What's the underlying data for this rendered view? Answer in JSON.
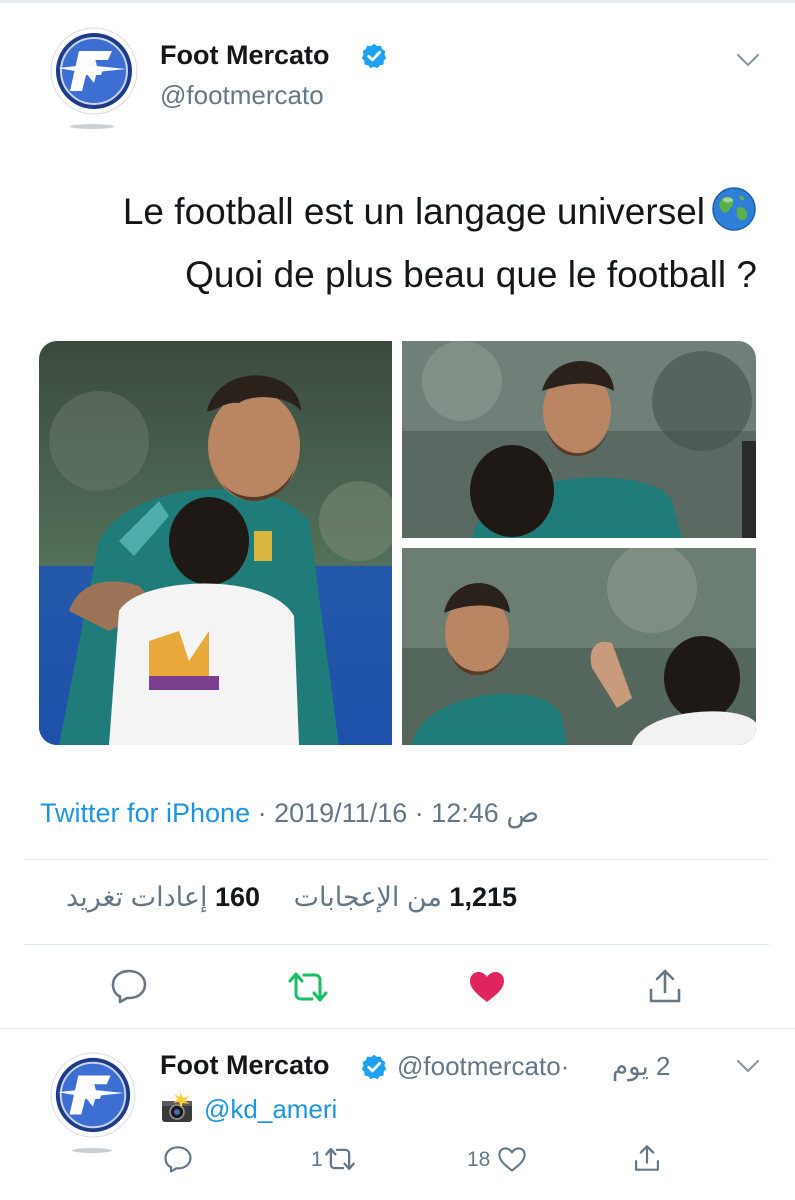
{
  "tweet": {
    "author_name": "Foot Mercato",
    "author_handle": "@footmercato",
    "text_line1": "Le football est un langage universel",
    "text_line2": "Quoi de plus beau que le football ?",
    "source": "Twitter for iPhone",
    "separator": " · ",
    "date": "2019/11/16",
    "time": "12:46 ص",
    "likes_count": "1,215",
    "likes_label": "من الإعجابات",
    "retweets_count": "160",
    "retweets_label": "إعادات تغريد",
    "liked": true,
    "icons": [
      "verified-badge-icon",
      "chevron-down-icon",
      "globe-icon",
      "reply-icon",
      "retweet-icon",
      "heart-icon",
      "share-icon"
    ],
    "photos": [
      {
        "name": "photo-messi-hug-child"
      },
      {
        "name": "photo-messi-smiling-child"
      },
      {
        "name": "photo-messi-high-five"
      }
    ]
  },
  "reply": {
    "author_name": "Foot Mercato",
    "author_handle": "@footmercato",
    "dot": "·",
    "time": "2 يوم",
    "mention": "@kd_ameri",
    "retweets_count": "1",
    "likes_count": "18",
    "icons": [
      "camera-flash-icon",
      "reply-icon",
      "retweet-icon",
      "heart-outline-icon",
      "share-icon"
    ]
  },
  "colors": {
    "link": "#1b95e0",
    "secondary_text": "#657786",
    "retweet_green": "#17bf63",
    "like_red": "#e0245e",
    "divider": "#e1e8ed"
  }
}
